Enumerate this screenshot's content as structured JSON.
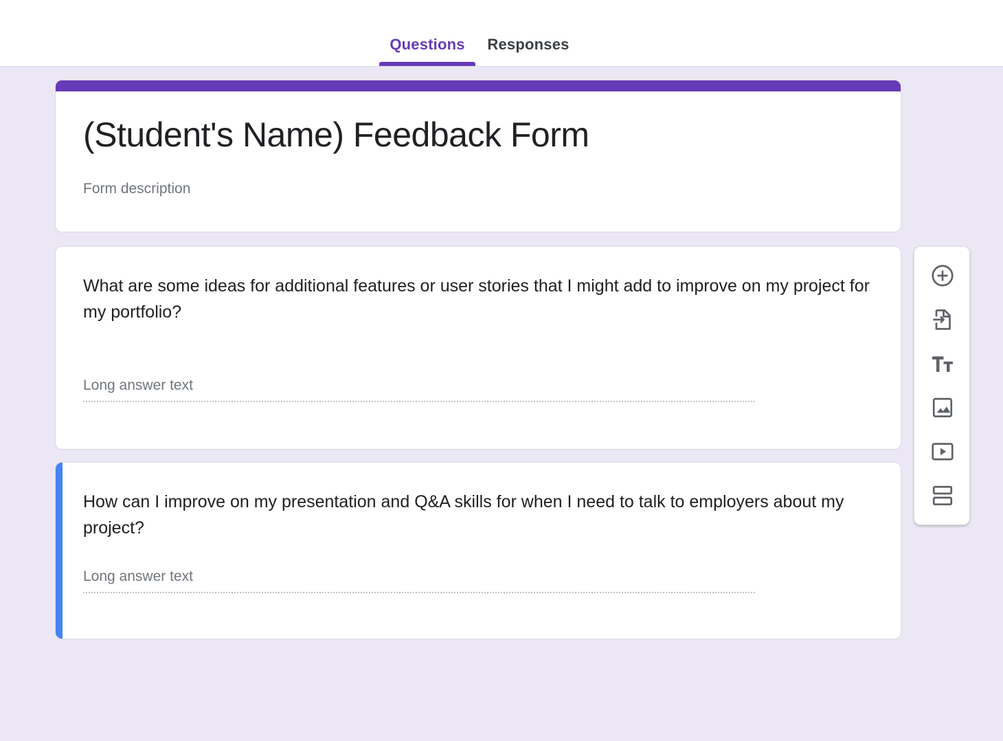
{
  "tabs": {
    "questions": "Questions",
    "responses": "Responses"
  },
  "form": {
    "title": "(Student's Name) Feedback Form",
    "description_placeholder": "Form description"
  },
  "questions": [
    {
      "text": "What are some ideas for additional features or user stories that I might add to improve on my project for my portfolio?",
      "answer_placeholder": "Long answer text"
    },
    {
      "text": "How can I improve on my presentation and Q&A skills for when I need to talk to employers about my project?",
      "answer_placeholder": "Long answer text"
    }
  ],
  "toolbar": {
    "items": [
      "add-question-icon",
      "import-questions-icon",
      "add-title-icon",
      "add-image-icon",
      "add-video-icon",
      "add-section-icon"
    ]
  },
  "colors": {
    "accent": "#673ab7",
    "active_question": "#4285f4",
    "background": "#ebe7f5"
  }
}
